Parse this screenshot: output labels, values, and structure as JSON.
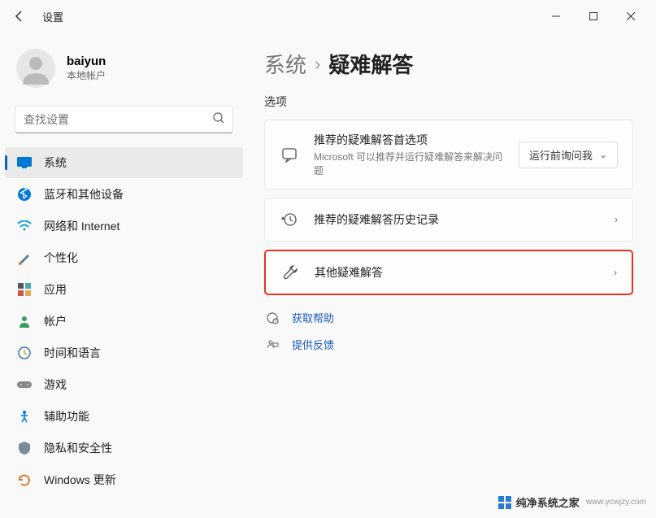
{
  "window": {
    "title": "设置"
  },
  "profile": {
    "name": "baiyun",
    "sub": "本地帐户"
  },
  "search": {
    "placeholder": "查找设置"
  },
  "nav": {
    "items": [
      {
        "label": "系统"
      },
      {
        "label": "蓝牙和其他设备"
      },
      {
        "label": "网络和 Internet"
      },
      {
        "label": "个性化"
      },
      {
        "label": "应用"
      },
      {
        "label": "帐户"
      },
      {
        "label": "时间和语言"
      },
      {
        "label": "游戏"
      },
      {
        "label": "辅助功能"
      },
      {
        "label": "隐私和安全性"
      },
      {
        "label": "Windows 更新"
      }
    ]
  },
  "breadcrumb": {
    "root": "系统",
    "leaf": "疑难解答"
  },
  "section": "选项",
  "cards": {
    "pref": {
      "title": "推荐的疑难解答首选项",
      "sub": "Microsoft 可以推荐并运行疑难解答来解决问题",
      "action": "运行前询问我"
    },
    "history": {
      "title": "推荐的疑难解答历史记录"
    },
    "other": {
      "title": "其他疑难解答"
    }
  },
  "links": {
    "help": "获取帮助",
    "feedback": "提供反馈"
  },
  "watermark": {
    "text": "纯净系统之家",
    "url": "www.ycwjzy.com"
  }
}
